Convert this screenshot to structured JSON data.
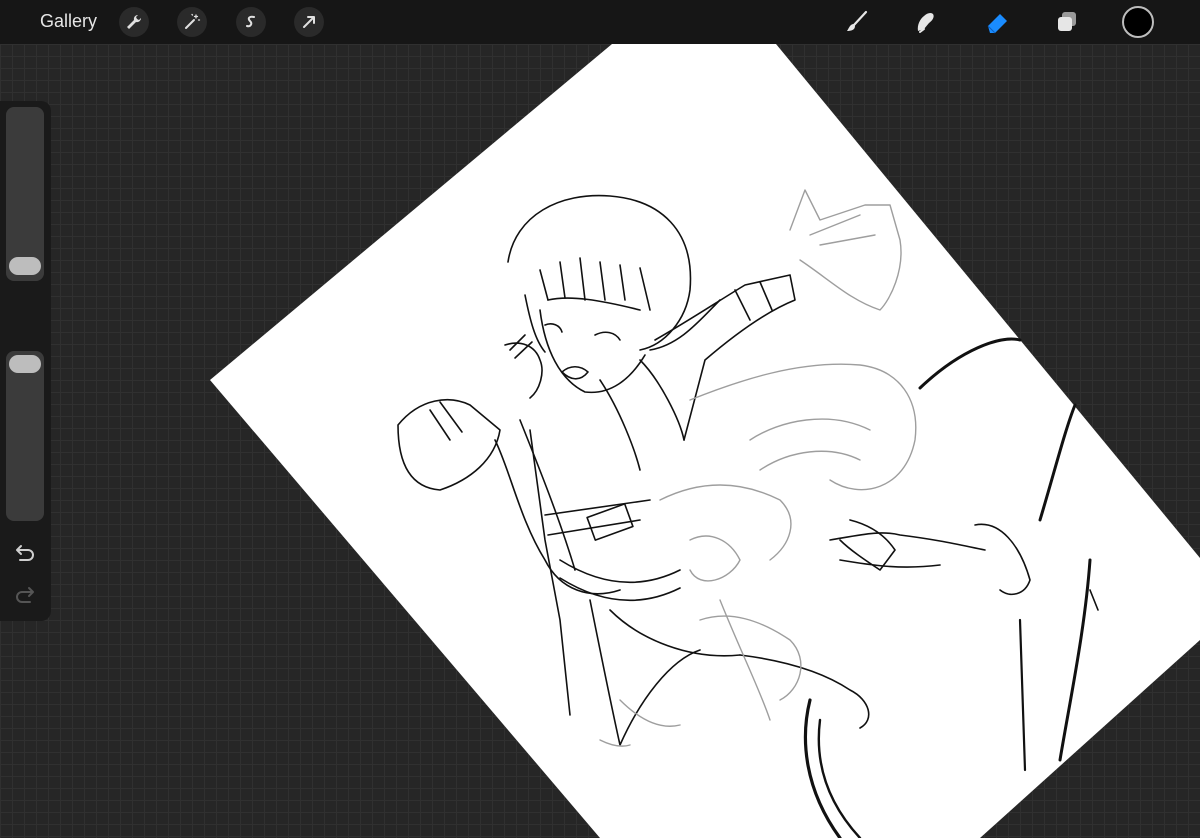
{
  "topbar": {
    "gallery_label": "Gallery",
    "left_tools": [
      "wrench-icon",
      "magic-wand-icon",
      "selection-icon",
      "transform-arrow-icon"
    ],
    "right_tools": [
      "brush-icon",
      "smudge-icon",
      "eraser-icon",
      "layers-icon",
      "color-picker"
    ],
    "active_tool": "eraser-icon",
    "active_color": "#1a8cff",
    "current_color": "#000000"
  },
  "sidebar": {
    "brush_size_level": 0.08,
    "opacity_level": 1.0,
    "controls": [
      "brush-size-slider",
      "modify-button",
      "opacity-slider",
      "undo-button",
      "redo-button"
    ]
  },
  "canvas": {
    "background": "#262626",
    "artwork": "line-art-sketch"
  }
}
